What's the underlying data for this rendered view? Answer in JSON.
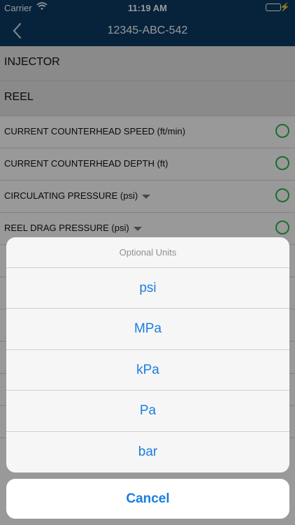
{
  "status_bar": {
    "carrier": "Carrier",
    "time": "11:19 AM"
  },
  "nav": {
    "title": "12345-ABC-542",
    "back_icon": "chevron-left-icon"
  },
  "sections": [
    {
      "label": "INJECTOR"
    },
    {
      "label": "REEL"
    }
  ],
  "rows": [
    {
      "label": "CURRENT COUNTERHEAD SPEED  (ft/min)",
      "has_unit_picker": false
    },
    {
      "label": "CURRENT COUNTERHEAD DEPTH  (ft)",
      "has_unit_picker": false
    },
    {
      "label": "CIRCULATING PRESSURE  (psi)",
      "has_unit_picker": true
    },
    {
      "label": "REEL DRAG PRESSURE  (psi)",
      "has_unit_picker": true
    }
  ],
  "action_sheet": {
    "title": "Optional Units",
    "options": [
      "psi",
      "MPa",
      "kPa",
      "Pa",
      "bar"
    ],
    "cancel_label": "Cancel"
  },
  "colors": {
    "nav_bg": "#0b3b63",
    "accent": "#1a7ee0",
    "status_ok": "#2fb84a"
  }
}
